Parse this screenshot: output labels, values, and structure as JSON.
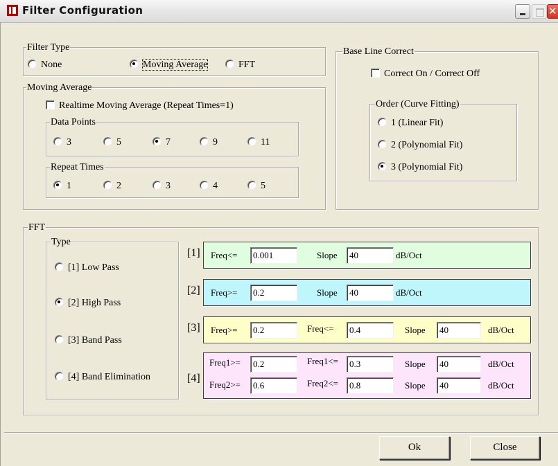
{
  "window": {
    "title": "Filter Configuration"
  },
  "filter_type": {
    "legend": "Filter Type",
    "options": [
      {
        "label": "None",
        "checked": false
      },
      {
        "label": "Moving Average",
        "checked": true
      },
      {
        "label": "FFT",
        "checked": false
      }
    ]
  },
  "baseline": {
    "legend": "Base Line Correct",
    "toggle_label": "Correct On / Correct Off",
    "order_legend": "Order (Curve Fitting)",
    "orders": [
      {
        "label": "1 (Linear Fit)",
        "checked": false
      },
      {
        "label": "2 (Polynomial Fit)",
        "checked": false
      },
      {
        "label": "3 (Polynomial Fit)",
        "checked": true
      }
    ]
  },
  "moving_average": {
    "legend": "Moving Average",
    "realtime_label": "Realtime Moving Average (Repeat Times=1)",
    "data_points": {
      "legend": "Data Points",
      "options": [
        {
          "label": "3",
          "checked": false
        },
        {
          "label": "5",
          "checked": false
        },
        {
          "label": "7",
          "checked": true
        },
        {
          "label": "9",
          "checked": false
        },
        {
          "label": "11",
          "checked": false
        }
      ]
    },
    "repeat_times": {
      "legend": "Repeat Times",
      "options": [
        {
          "label": "1",
          "checked": true
        },
        {
          "label": "2",
          "checked": false
        },
        {
          "label": "3",
          "checked": false
        },
        {
          "label": "4",
          "checked": false
        },
        {
          "label": "5",
          "checked": false
        }
      ]
    }
  },
  "fft": {
    "legend": "FFT",
    "type_legend": "Type",
    "types": [
      {
        "label": "[1] Low Pass",
        "checked": false
      },
      {
        "label": "[2] High Pass",
        "checked": true
      },
      {
        "label": "[3] Band Pass",
        "checked": false
      },
      {
        "label": "[4] Band Elimination",
        "checked": false
      }
    ],
    "colors": {
      "low_pass": "#e1fde0",
      "high_pass": "#bff6fb",
      "band_pass": "#fefec8",
      "band_elim": "#fde6fc"
    },
    "low_pass": {
      "index": "[1]",
      "freq_label": "Freq<=",
      "freq": "0.001",
      "slope_label": "Slope",
      "slope": "40",
      "unit": "dB/Oct"
    },
    "high_pass": {
      "index": "[2]",
      "freq_label": "Freq>=",
      "freq": "0.2",
      "slope_label": "Slope",
      "slope": "40",
      "unit": "dB/Oct"
    },
    "band_pass": {
      "index": "[3]",
      "freq_low_label": "Freq>=",
      "freq_low": "0.2",
      "freq_high_label": "Freq<=",
      "freq_high": "0.4",
      "slope_label": "Slope",
      "slope": "40",
      "unit": "dB/Oct"
    },
    "band_elim": {
      "index": "[4]",
      "freq1_low_label": "Freq1>=",
      "freq1_low": "0.2",
      "freq1_high_label": "Freq1<=",
      "freq1_high": "0.3",
      "slope1_label": "Slope",
      "slope1": "40",
      "unit1": "dB/Oct",
      "freq2_low_label": "Freq2>=",
      "freq2_low": "0.6",
      "freq2_high_label": "Freq2<=",
      "freq2_high": "0.8",
      "slope2_label": "Slope",
      "slope2": "40",
      "unit2": "dB/Oct"
    }
  },
  "buttons": {
    "ok": "Ok",
    "close": "Close"
  }
}
